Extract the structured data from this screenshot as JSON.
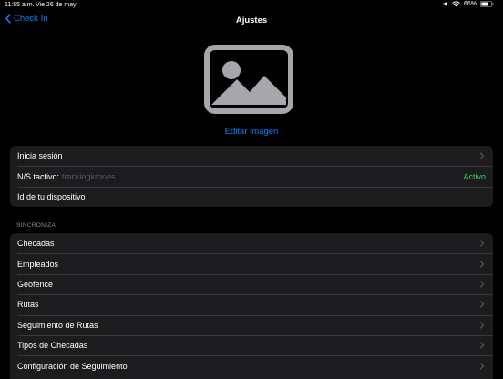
{
  "status_bar": {
    "time": "11:55 a.m.",
    "date": "Vie 26 de may",
    "battery": "66%"
  },
  "nav": {
    "back_label": "Check In",
    "title": "Ajustes"
  },
  "profile": {
    "edit_image_label": "Editar imagen"
  },
  "account": {
    "login_label": "Inicia sesión",
    "serial_label": "N/S tactivo:",
    "serial_value": "trackingkrones",
    "serial_status": "Activo",
    "device_id_label": "Id de tu dispositivo"
  },
  "sync": {
    "header": "SINCRONIZA",
    "items": [
      {
        "label": "Checadas"
      },
      {
        "label": "Empleados"
      },
      {
        "label": "Geofence"
      },
      {
        "label": "Rutas"
      },
      {
        "label": "Seguimiento de Rutas"
      },
      {
        "label": "Tipos de Checadas"
      },
      {
        "label": "Configuración de Seguimiento"
      }
    ]
  },
  "colors": {
    "accent": "#0a84ff",
    "status_active": "#30d158",
    "background": "#000000",
    "group_background": "#1c1c1e"
  },
  "icons": {
    "back": "chevron-left-icon",
    "row": "chevron-right-icon",
    "image": "image-placeholder-icon",
    "location": "location-arrow-icon",
    "wifi": "wifi-icon",
    "battery": "battery-icon"
  }
}
